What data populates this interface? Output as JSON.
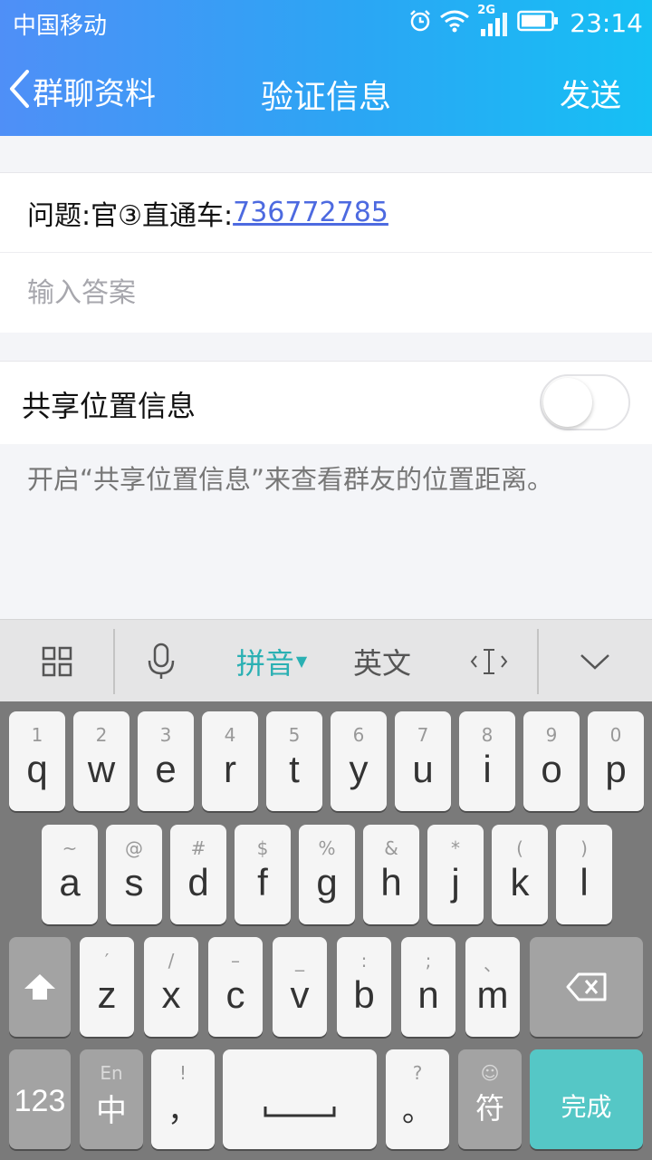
{
  "status_bar": {
    "carrier": "中国移动",
    "network": "2G",
    "time": "23:14"
  },
  "nav": {
    "back_label": "群聊资料",
    "title": "验证信息",
    "send_label": "发送"
  },
  "question": {
    "label": "问题:官③直通车:",
    "link": "736772785"
  },
  "answer": {
    "placeholder": "输入答案",
    "value": ""
  },
  "share_location": {
    "label": "共享位置信息",
    "enabled": false,
    "description": "开启“共享位置信息”来查看群友的位置距离。"
  },
  "keyboard_toolbar": {
    "grid_icon": "grid-icon",
    "mic_icon": "microphone-icon",
    "pinyin_label": "拼音",
    "english_label": "英文",
    "cursor_icon": "text-cursor-icon",
    "collapse_icon": "chevron-down-icon"
  },
  "keyboard": {
    "row1": [
      {
        "hint": "1",
        "key": "q"
      },
      {
        "hint": "2",
        "key": "w"
      },
      {
        "hint": "3",
        "key": "e"
      },
      {
        "hint": "4",
        "key": "r"
      },
      {
        "hint": "5",
        "key": "t"
      },
      {
        "hint": "6",
        "key": "y"
      },
      {
        "hint": "7",
        "key": "u"
      },
      {
        "hint": "8",
        "key": "i"
      },
      {
        "hint": "9",
        "key": "o"
      },
      {
        "hint": "0",
        "key": "p"
      }
    ],
    "row2": [
      {
        "hint": "~",
        "key": "a"
      },
      {
        "hint": "@",
        "key": "s"
      },
      {
        "hint": "#",
        "key": "d"
      },
      {
        "hint": "$",
        "key": "f"
      },
      {
        "hint": "%",
        "key": "g"
      },
      {
        "hint": "&",
        "key": "h"
      },
      {
        "hint": "*",
        "key": "j"
      },
      {
        "hint": "(",
        "key": "k"
      },
      {
        "hint": ")",
        "key": "l"
      }
    ],
    "row3": [
      {
        "hint": "′",
        "key": "z"
      },
      {
        "hint": "/",
        "key": "x"
      },
      {
        "hint": "–",
        "key": "c"
      },
      {
        "hint": "_",
        "key": "v"
      },
      {
        "hint": ":",
        "key": "b"
      },
      {
        "hint": ";",
        "key": "n"
      },
      {
        "hint": "、",
        "key": "m"
      }
    ],
    "num_label": "123",
    "lang_hint": "En",
    "lang_label": "中",
    "comma_hint": "!",
    "comma_label": "，",
    "period_hint": "?",
    "period_label": "。",
    "emoji_hint": "☺",
    "symbol_label": "符",
    "done_label": "完成"
  }
}
